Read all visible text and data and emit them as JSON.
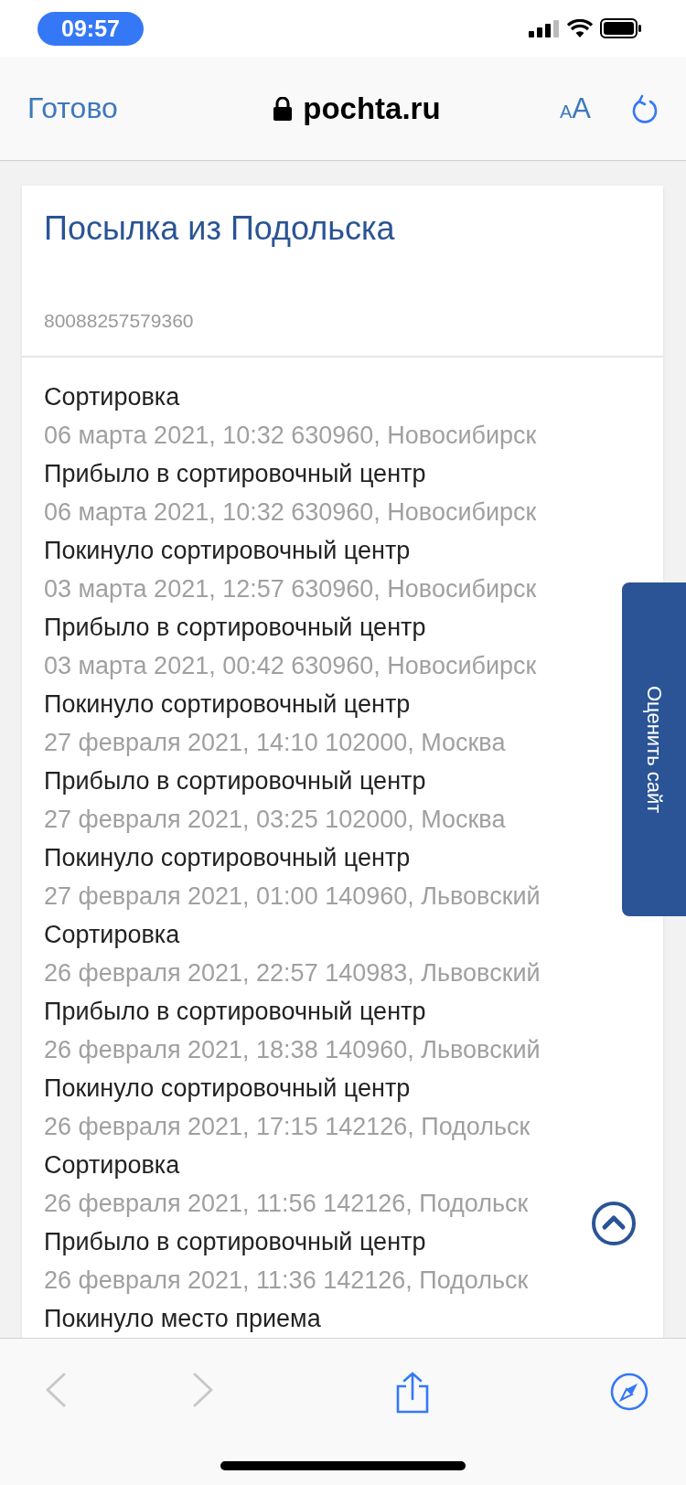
{
  "status_bar": {
    "time": "09:57"
  },
  "browser": {
    "done": "Готово",
    "domain": "pochta.ru",
    "text_size": {
      "small": "A",
      "large": "A"
    }
  },
  "parcel": {
    "title": "Посылка из Подольска",
    "tracking_number": "80088257579360",
    "events": [
      {
        "status": "Сортировка",
        "meta": "06 марта 2021, 10:32 630960, Новосибирск"
      },
      {
        "status": "Прибыло в сортировочный центр",
        "meta": "06 марта 2021, 10:32 630960, Новосибирск"
      },
      {
        "status": "Покинуло сортировочный центр",
        "meta": "03 марта 2021, 12:57 630960, Новосибирск"
      },
      {
        "status": "Прибыло в сортировочный центр",
        "meta": "03 марта 2021, 00:42 630960, Новосибирск"
      },
      {
        "status": "Покинуло сортировочный центр",
        "meta": "27 февраля 2021, 14:10 102000, Москва"
      },
      {
        "status": "Прибыло в сортировочный центр",
        "meta": "27 февраля 2021, 03:25 102000, Москва"
      },
      {
        "status": "Покинуло сортировочный центр",
        "meta": "27 февраля 2021, 01:00 140960, Львовский"
      },
      {
        "status": "Сортировка",
        "meta": "26 февраля 2021, 22:57 140983, Львовский"
      },
      {
        "status": "Прибыло в сортировочный центр",
        "meta": "26 февраля 2021, 18:38 140960, Львовский"
      },
      {
        "status": "Покинуло сортировочный центр",
        "meta": "26 февраля 2021, 17:15 142126, Подольск"
      },
      {
        "status": "Сортировка",
        "meta": "26 февраля 2021, 11:56 142126, Подольск"
      },
      {
        "status": "Прибыло в сортировочный центр",
        "meta": "26 февраля 2021, 11:36 142126, Подольск"
      },
      {
        "status": "Покинуло место приема"
      }
    ]
  },
  "feedback_tab": {
    "label": "Оценить сайт"
  },
  "toolbar": {
    "back": {
      "disabled": true
    },
    "forward": {
      "disabled": true
    }
  }
}
